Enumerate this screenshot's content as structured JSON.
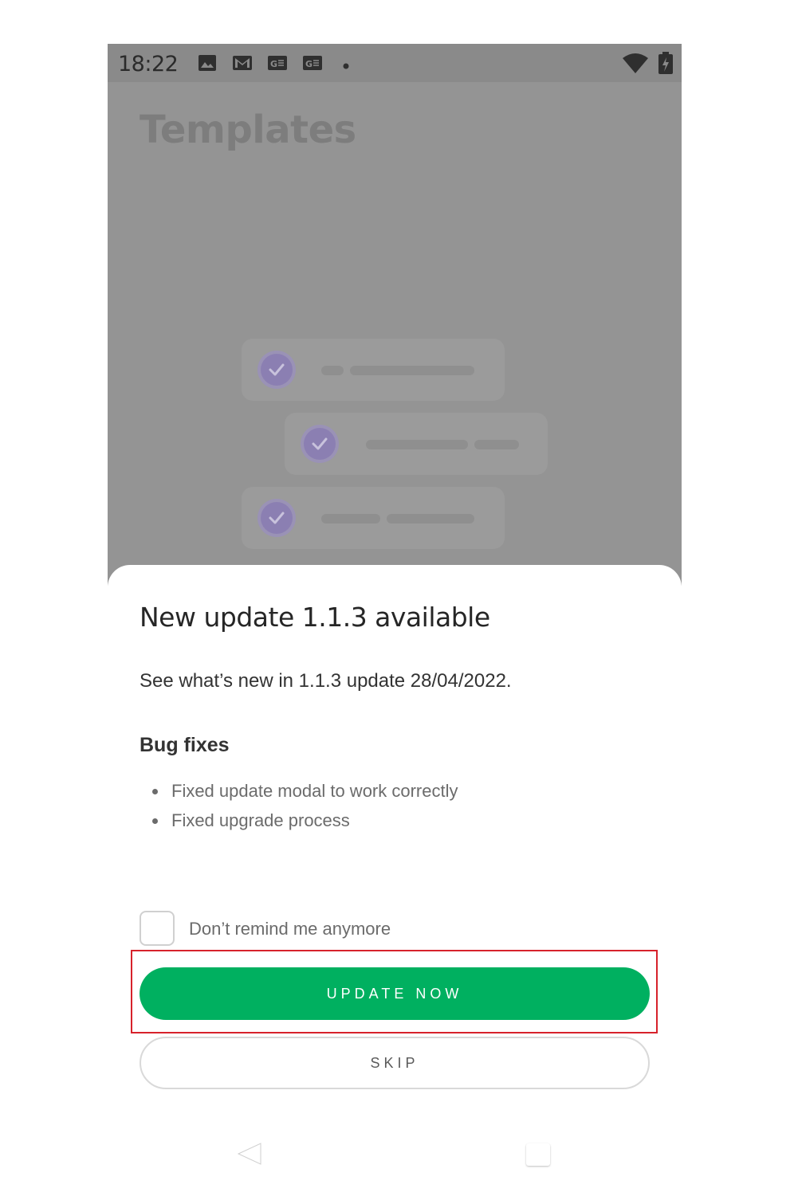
{
  "status_bar": {
    "time": "18:22",
    "icons": [
      "image-icon",
      "gmail-icon",
      "translate-icon",
      "translate-icon",
      "dot-icon",
      "wifi-icon",
      "battery-charging-icon"
    ]
  },
  "background_app": {
    "title": "Templates"
  },
  "update_sheet": {
    "title": "New update 1.1.3 available",
    "subtitle": "See what’s new in 1.1.3 update 28/04/2022.",
    "section_heading": "Bug fixes",
    "changes": [
      "Fixed update modal to work correctly",
      "Fixed upgrade process"
    ],
    "dont_remind_label": "Don’t remind me anymore",
    "dont_remind_checked": false,
    "update_button_label": "UPDATE NOW",
    "skip_button_label": "SKIP"
  },
  "colors": {
    "primary_green": "#00b060",
    "highlight_red": "#d7222b",
    "scrim_gray": "#949494"
  },
  "navigation_bar": {
    "icons": [
      "back-icon",
      "recent-apps-icon"
    ]
  }
}
